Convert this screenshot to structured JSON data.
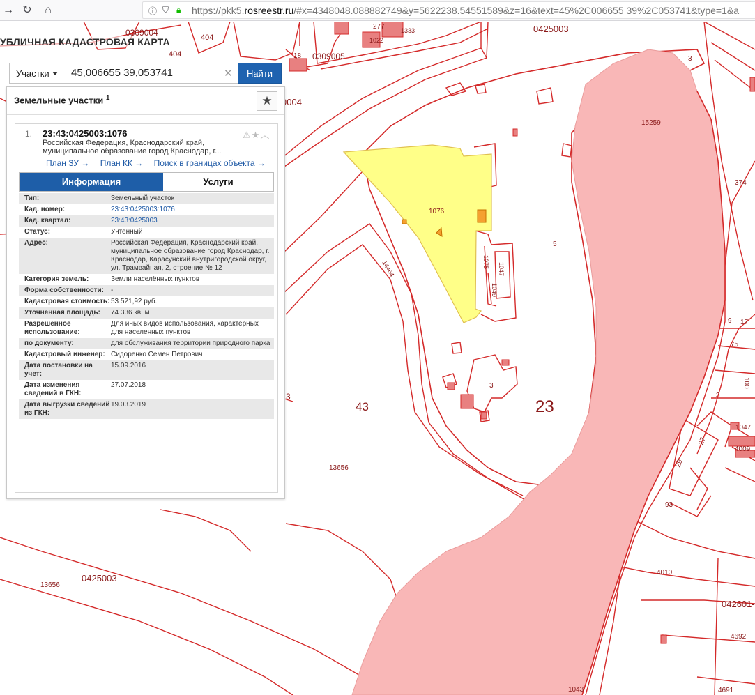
{
  "browser": {
    "url_prefix": "https://pkk5.",
    "url_domain": "rosreestr.ru",
    "url_rest": "/#x=4348048.088882749&y=5622238.54551589&z=16&text=45%2C006655 39%2C053741&type=1&a"
  },
  "app": {
    "title": "УБЛИЧНАЯ КАДАСТРОВАЯ КАРТА"
  },
  "search": {
    "type_label": "Участки",
    "value": "45,006655 39,053741",
    "button_label": "Найти"
  },
  "panel": {
    "title": "Земельные участки",
    "count": "1",
    "card": {
      "index": "1.",
      "cad_number": "23:43:0425003:1076",
      "address_short": "Российская Федерация, Краснодарский край, муниципальное образование город Краснодар, г...",
      "links": [
        "План ЗУ →",
        "План КК →",
        "Поиск в границах объекта →"
      ],
      "tabs": {
        "info": "Информация",
        "services": "Услуги"
      },
      "rows": [
        {
          "k": "Тип:",
          "v": "Земельный участок"
        },
        {
          "k": "Кад. номер:",
          "v": "23:43:0425003:1076"
        },
        {
          "k": "Кад. квартал:",
          "v": "23:43:0425003"
        },
        {
          "k": "Статус:",
          "v": "Учтенный"
        },
        {
          "k": "Адрес:",
          "v": "Российская Федерация, Краснодарский край, муниципальное образование город Краснодар, г. Краснодар, Карасунский внутригородской округ, ул. Трамвайная, 2, строение № 12"
        },
        {
          "k": "Категория земель:",
          "v": "Земли населённых пунктов"
        },
        {
          "k": "Форма собственности:",
          "v": "-"
        },
        {
          "k": "Кадастровая стоимость:",
          "v": "53 521,92 руб."
        },
        {
          "k": "Уточненная площадь:",
          "v": "74 336 кв. м"
        },
        {
          "k": "Разрешенное использование:",
          "v": "Для иных видов использования, характерных для населенных пунктов"
        },
        {
          "k": "по документу:",
          "v": "для обслуживания территории природного парка"
        },
        {
          "k": "Кадастровый инженер:",
          "v": "Сидоренко Семен Петрович"
        },
        {
          "k": "Дата постановки на учет:",
          "v": "15.09.2016"
        },
        {
          "k": "Дата изменения сведений в ГКН:",
          "v": "27.07.2018"
        },
        {
          "k": "Дата выгрузки сведений из ГКН:",
          "v": "19.03.2019"
        }
      ]
    }
  },
  "map": {
    "labels": {
      "q0309004": "0309004",
      "n404a": "404",
      "n404b": "404",
      "n18": "18",
      "q0309005": "0309005",
      "n277": "277",
      "n1022": "1022",
      "n1333": "1333",
      "q0425003_top": "0425003",
      "n9004": "9004",
      "n15259": "15259",
      "n374": "374",
      "n3a": "3",
      "n1076": "1076",
      "n5": "5",
      "n1075": "1075",
      "n1047a": "1047",
      "n1049": "1049",
      "n14464": "14464",
      "n9": "9",
      "n17": "17",
      "n75": "75",
      "n43": "43",
      "n23": "23",
      "n3b": "3",
      "n3c": "3",
      "n3d": "3",
      "n13656a": "13656",
      "n13656b": "13656",
      "q0425003_bot": "0425003",
      "n1047b": "1047",
      "n4009": "4009",
      "n29": "29",
      "n27": "27",
      "n93": "93",
      "n4010": "4010",
      "q042601": "042601-",
      "n4692": "4692",
      "n1043": "1043",
      "n4691": "4691",
      "n1006": "100"
    },
    "colors": {
      "boundary": "#d42a2a",
      "water": "#f9b7b7",
      "parcel_selected": "#ffff88",
      "building": "#e88080"
    }
  }
}
